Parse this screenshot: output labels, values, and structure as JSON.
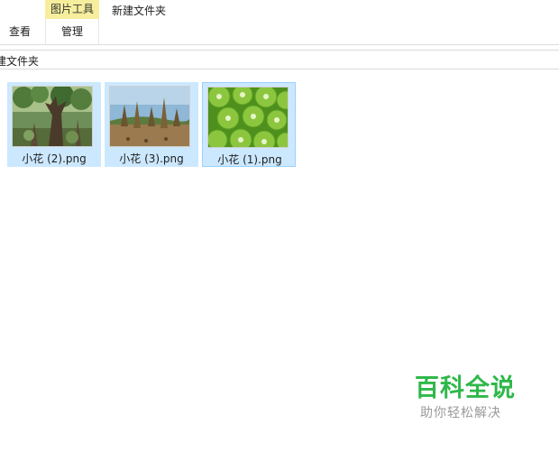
{
  "ribbon": {
    "contextual_group_label": "图片工具",
    "contextual_tab_label": "管理",
    "view_tab_label": "查看",
    "window_title": "新建文件夹",
    "contextual_color": "#f6ee9c"
  },
  "address_bar": {
    "path_text": "建文件夹"
  },
  "files": [
    {
      "name": "小花 (2).png",
      "thumbnail": "forest-tree-image",
      "selected": false
    },
    {
      "name": "小花 (3).png",
      "thumbnail": "cactus-field-image",
      "selected": false
    },
    {
      "name": "小花 (1).png",
      "thumbnail": "kiwi-slices-image",
      "selected": true
    }
  ],
  "watermark": {
    "title": "百科全说",
    "subtitle": "助你轻松解决"
  },
  "colors": {
    "selection_bg": "#cce8ff",
    "selection_border": "#99d1ff",
    "watermark_green": "#2fb84a"
  }
}
